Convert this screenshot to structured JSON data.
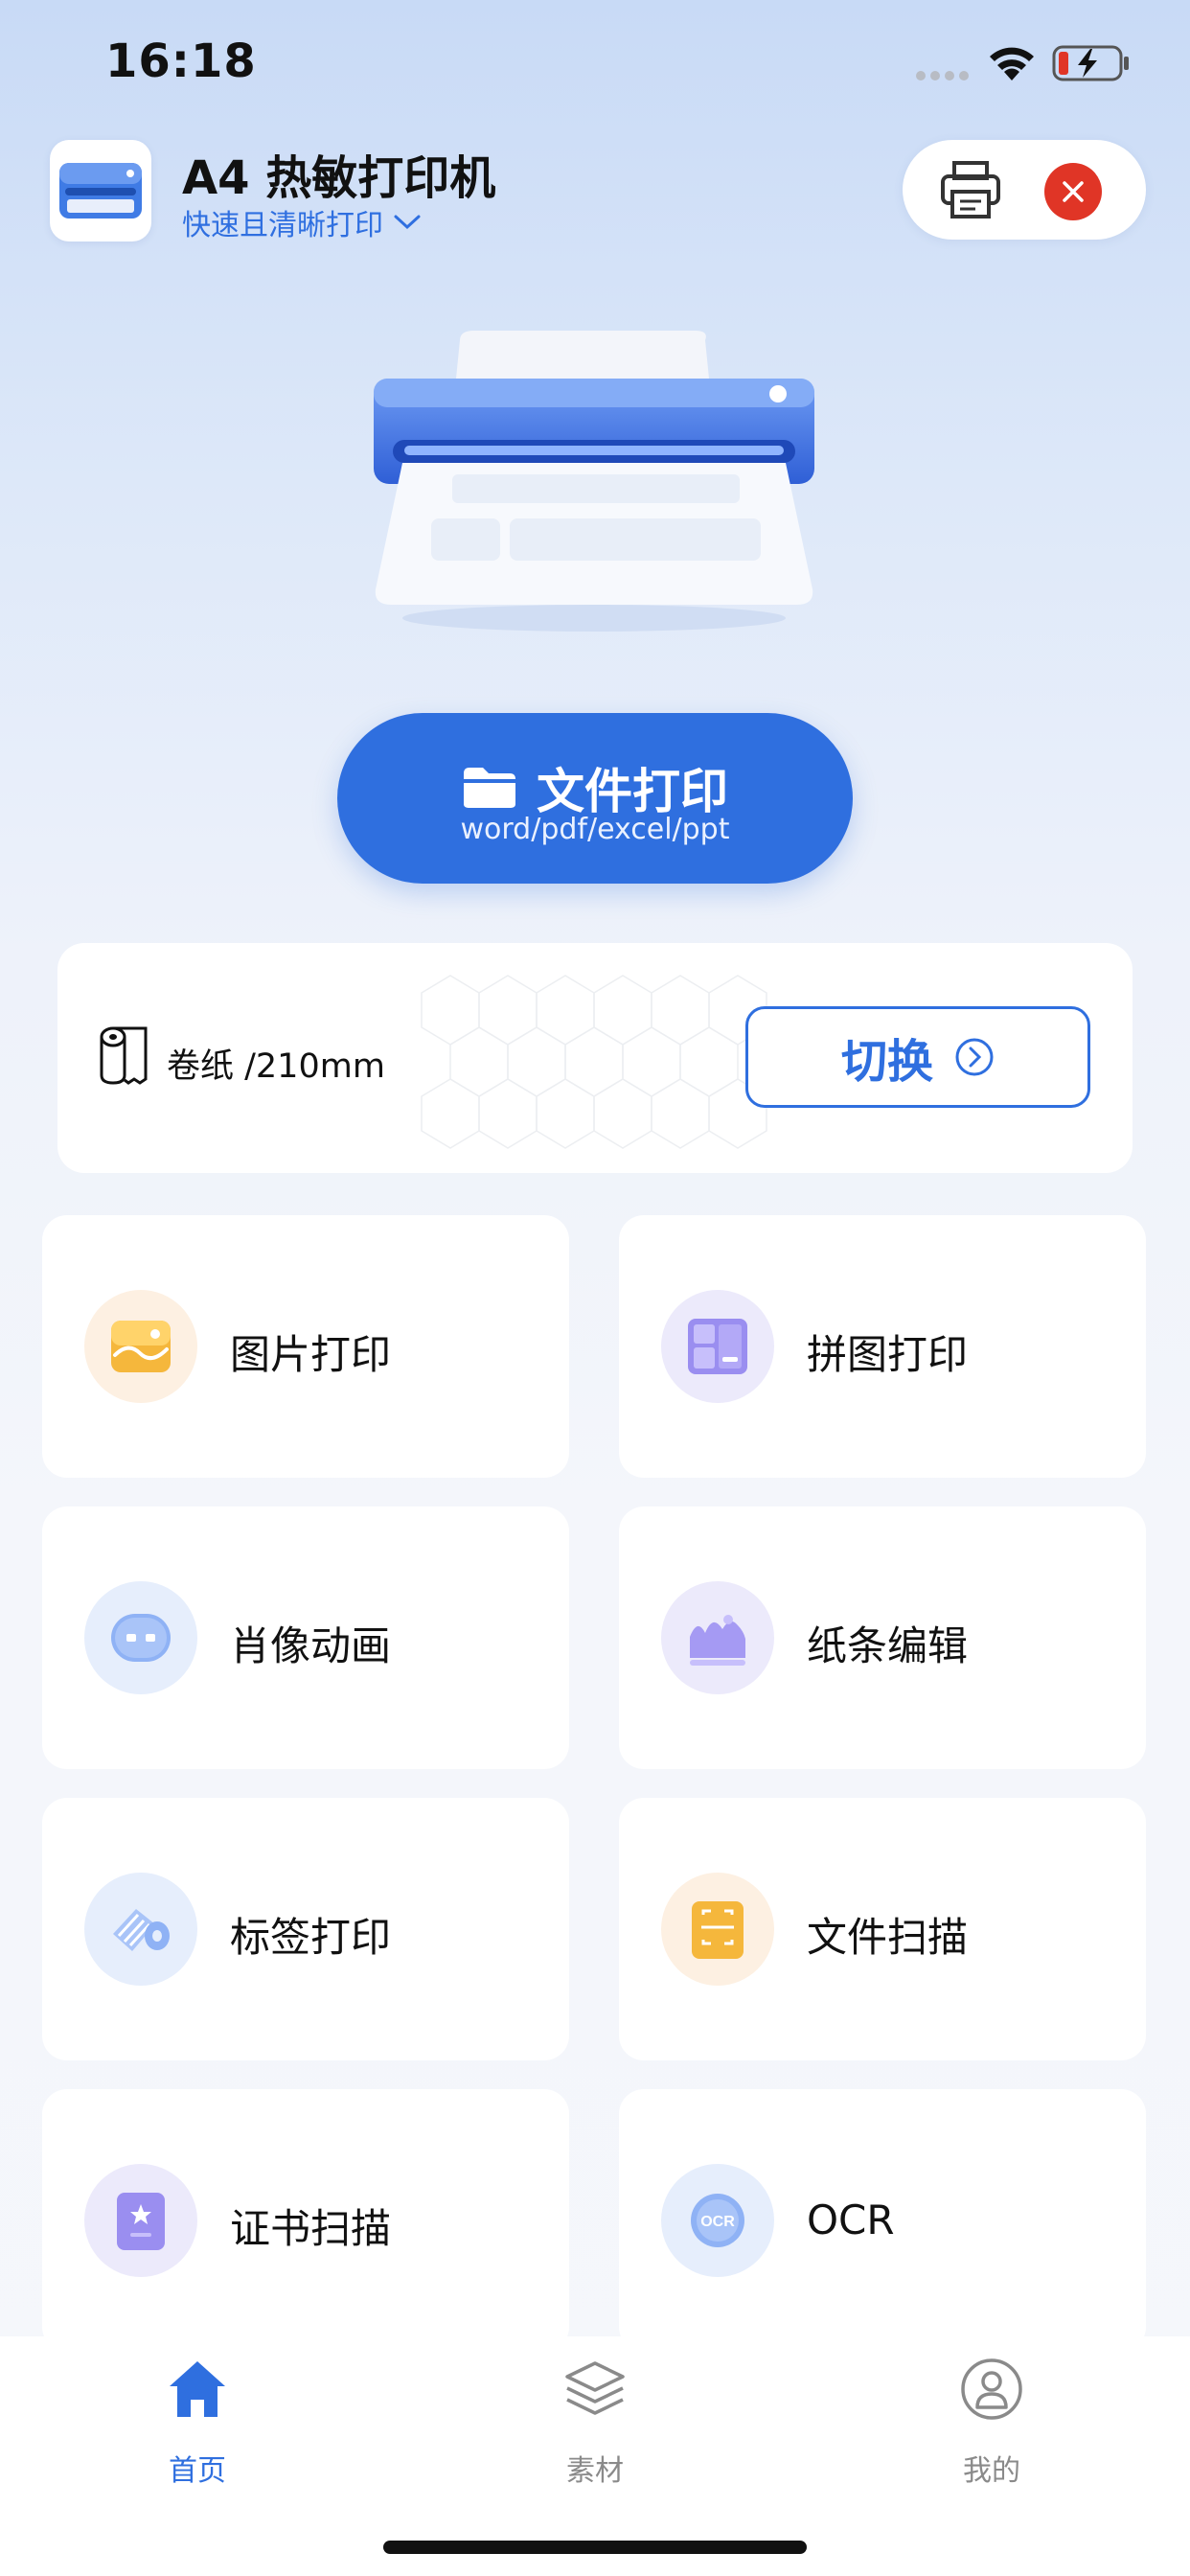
{
  "status_bar": {
    "time": "16:18",
    "icons": [
      "signal-icon",
      "wifi-icon",
      "battery-charging-icon"
    ],
    "battery_color": "#e03526"
  },
  "header": {
    "title": "A4 热敏打印机",
    "subtitle": "快速且清晰打印",
    "subtitle_icon": "chevron-down-icon",
    "printer_icon": "printer-icon",
    "close_icon": "close-icon"
  },
  "main_action": {
    "title": "文件打印",
    "subtitle": "word/pdf/excel/ppt",
    "icon": "folder-icon"
  },
  "paper": {
    "label": "卷纸 /210mm",
    "switch_label": "切换",
    "icon": "paper-roll-icon"
  },
  "features": [
    {
      "label": "图片打印",
      "icon": "image-icon"
    },
    {
      "label": "拼图打印",
      "icon": "collage-icon"
    },
    {
      "label": "肖像动画",
      "icon": "portrait-animation-icon"
    },
    {
      "label": "纸条编辑",
      "icon": "mountain-picture-icon"
    },
    {
      "label": "标签打印",
      "icon": "label-roll-icon"
    },
    {
      "label": "文件扫描",
      "icon": "scan-icon"
    },
    {
      "label": "证书扫描",
      "icon": "certificate-icon"
    },
    {
      "label": "OCR",
      "icon": "ocr-icon"
    }
  ],
  "tabs": [
    {
      "label": "首页",
      "icon": "home-icon",
      "active": true
    },
    {
      "label": "素材",
      "icon": "layers-icon",
      "active": false
    },
    {
      "label": "我的",
      "icon": "user-icon",
      "active": false
    }
  ],
  "colors": {
    "accent": "#2f6fdf",
    "close": "#e03526"
  }
}
